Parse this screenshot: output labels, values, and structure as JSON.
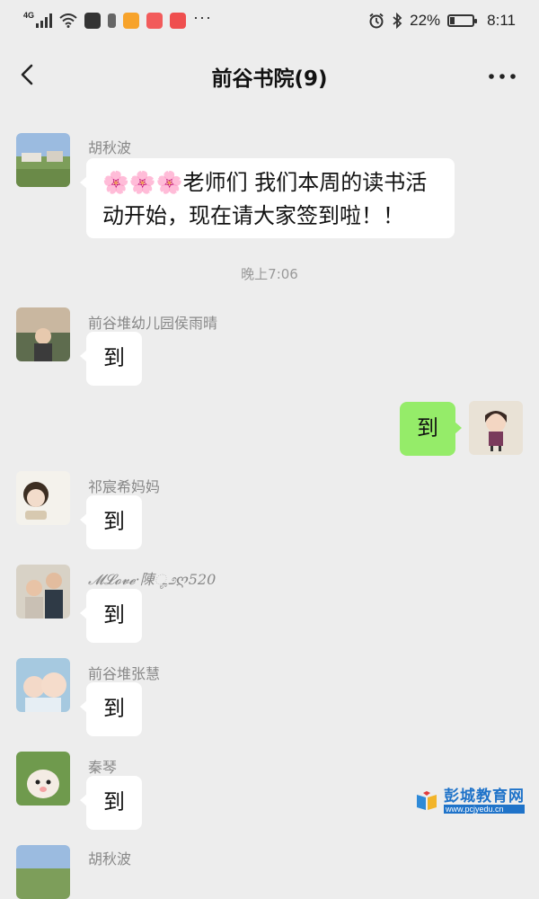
{
  "status_bar": {
    "network": "4G",
    "battery_percent": "22%",
    "battery_level": 0.22,
    "time": "8:11"
  },
  "header": {
    "title": "前谷书院(9)"
  },
  "messages": [
    {
      "sender": "胡秋波",
      "text": "🌸🌸🌸老师们 我们本周的读书活动开始，现在请大家签到啦！！",
      "line1": "🌸🌸🌸老师们 我们本周的读书活",
      "line2": "动开始，现在请大家签到啦！！"
    },
    {
      "sender": "前谷堆幼儿园侯雨晴",
      "text": "到"
    },
    {
      "sender": "",
      "text": "到",
      "self": true
    },
    {
      "sender": "祁宸希妈妈",
      "text": "到"
    },
    {
      "sender": "𝓜𝓛𝓸𝓿𝓮·陳ೄ೨ღ520",
      "text": "到"
    },
    {
      "sender": "前谷堆张慧",
      "text": "到"
    },
    {
      "sender": "秦琴",
      "text": "到"
    },
    {
      "sender": "胡秋波",
      "text": ""
    }
  ],
  "timestamp": "晚上7:06",
  "watermark": {
    "text": "彭城教育网",
    "url": "www.pcjyedu.cn"
  },
  "colors": {
    "background": "#ededed",
    "self_bubble": "#95ec69",
    "other_bubble": "#ffffff"
  }
}
